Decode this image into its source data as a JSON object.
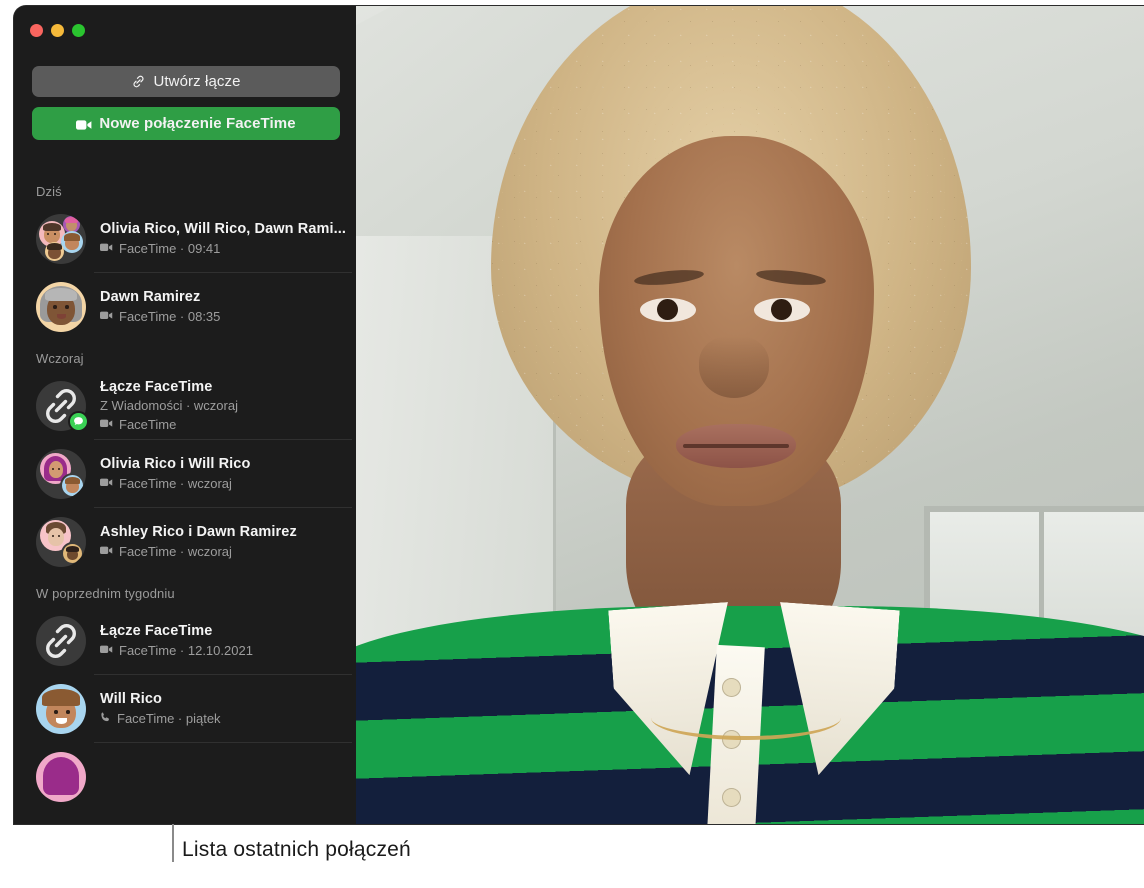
{
  "window": {
    "traffic_lights": [
      {
        "name": "close",
        "color": "#f9655f"
      },
      {
        "name": "minimize",
        "color": "#f5b93a"
      },
      {
        "name": "zoom",
        "color": "#2ac42f"
      }
    ]
  },
  "toolbar": {
    "create_link_label": "Utwórz łącze",
    "create_link_icon": "link-icon",
    "new_call_label": "Nowe połączenie FaceTime",
    "new_call_icon": "video-camera-icon",
    "new_call_color": "#2f9e45"
  },
  "recents": {
    "groups": [
      {
        "heading": "Dziś",
        "items": [
          {
            "title": "Olivia Rico, Will Rico, Dawn Rami...",
            "meta": "FaceTime · 09:41",
            "meta_icon": "video-camera-icon",
            "avatar": "group-four-memoji",
            "badge": null,
            "secondary": null
          },
          {
            "title": "Dawn Ramirez",
            "meta": "FaceTime · 08:35",
            "meta_icon": "video-camera-icon",
            "avatar": "memoji-dawn",
            "badge": null,
            "secondary": null
          }
        ]
      },
      {
        "heading": "Wczoraj",
        "items": [
          {
            "title": "Łącze FaceTime",
            "secondary": "Z Wiadomości · wczoraj",
            "meta": "FaceTime",
            "meta_icon": "video-camera-icon",
            "avatar": "link-icon",
            "badge": "messages-badge"
          },
          {
            "title": "Olivia Rico i Will Rico",
            "meta": "FaceTime · wczoraj",
            "meta_icon": "video-camera-icon",
            "avatar": "pair-olivia-will",
            "badge": null,
            "secondary": null
          },
          {
            "title": "Ashley Rico i Dawn Ramirez",
            "meta": "FaceTime · wczoraj",
            "meta_icon": "video-camera-icon",
            "avatar": "pair-ashley-dawn",
            "badge": null,
            "secondary": null
          }
        ]
      },
      {
        "heading": "W poprzednim tygodniu",
        "items": [
          {
            "title": "Łącze FaceTime",
            "meta": "FaceTime · 12.10.2021",
            "meta_icon": "video-camera-icon",
            "avatar": "link-icon",
            "badge": null,
            "secondary": null
          },
          {
            "title": "Will Rico",
            "meta": "FaceTime · piątek",
            "meta_icon": "phone-icon",
            "avatar": "memoji-will",
            "badge": null,
            "secondary": null
          }
        ]
      }
    ]
  },
  "video": {
    "description": "FaceTime self-view of a person with blonde curly hair wearing a green and navy striped rugby shirt"
  },
  "callout": {
    "label": "Lista ostatnich połączeń"
  }
}
